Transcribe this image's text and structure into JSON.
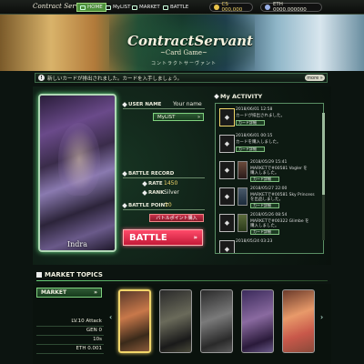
{
  "nav": {
    "logo": "Contract Servant",
    "items": [
      {
        "label": "HOME",
        "icon": "home-icon"
      },
      {
        "label": "MyLIST",
        "icon": "list-icon"
      },
      {
        "label": "MARKET",
        "icon": "market-icon"
      },
      {
        "label": "BATTLE",
        "icon": "battle-icon"
      }
    ],
    "cs_label": "CS 000,000",
    "eth_label": "ETH 0000.000000"
  },
  "banner": {
    "title": "ContractServant",
    "subtitle": "~Card Game~",
    "kana": "コントラクトサーヴァント"
  },
  "notice": {
    "text": "新しいカードが排出されました。カードを入手しましょう。",
    "more": "more »"
  },
  "profile": {
    "card_name": "Indra",
    "user_name_label": "USER NAME",
    "user_name_value": "Your name",
    "mylist_button": "MyLIST",
    "battle_record_label": "BATTLE RECORD",
    "rate_label": "RATE",
    "rate_value": "1450",
    "rank_label": "RANK",
    "rank_value": "Silver",
    "battle_point_label": "BATTLE POINT",
    "battle_point_value": "10",
    "buy_points_button": "バトルポイント購入",
    "battle_button": "BATTLE"
  },
  "activity": {
    "title": "My ACTIVITY",
    "items": [
      {
        "date": "2018/06/01 12:58",
        "text": "カードが排出されました。",
        "button": "カード詳細"
      },
      {
        "date": "2018/06/01 00:15",
        "text": "カードを購入しました。",
        "button": "カード詳細"
      },
      {
        "date": "2018/05/29 15:41",
        "text": "MARKETで#00581 Vogler を",
        "text2": "購入しました。",
        "button": "カード詳細"
      },
      {
        "date": "2018/05/27 22:00",
        "text": "MARKETで#00581 Sky Princess",
        "text2": "を出品しました。",
        "button": "カード詳細"
      },
      {
        "date": "2018/05/26 08:54",
        "text": "MARKETで#00322 Glimbe を",
        "text2": "購入しました。",
        "button": "カード詳細"
      },
      {
        "date": "2018/05/24 03:23",
        "text": "",
        "button": ""
      }
    ]
  },
  "market": {
    "title": "MARKET TOPICS",
    "button": "MARKET",
    "level": "LV.10 Attack",
    "gen": "GEN 0",
    "time": "10s",
    "price": "ETH 0.001"
  }
}
